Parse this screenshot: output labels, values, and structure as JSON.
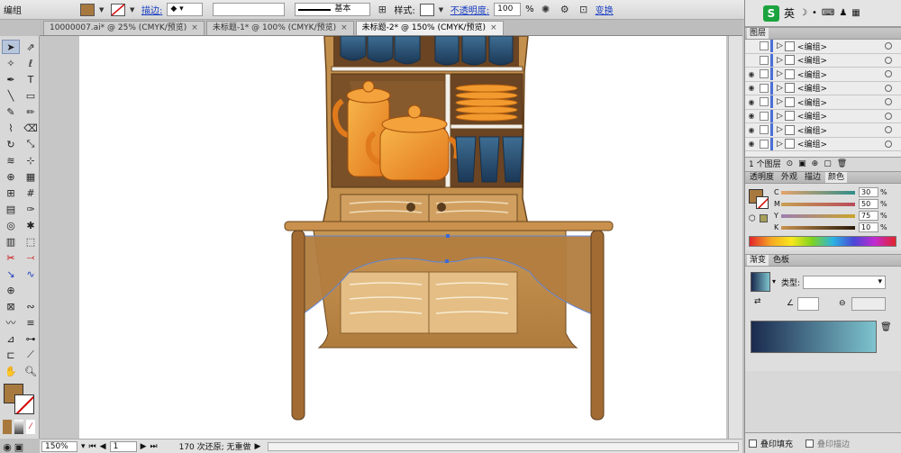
{
  "control_bar": {
    "object_type": "编组",
    "fill_color": "#a8793e",
    "stroke_label": "描边:",
    "style_label": "基本",
    "style_prefix": "样式:",
    "opacity_label": "不透明度:",
    "opacity_value": "100",
    "percent": "%",
    "transform_label": "变换"
  },
  "document_tabs": [
    {
      "label": "10000007.ai* @ 25% (CMYK/预览)",
      "close": "×"
    },
    {
      "label": "未标题-1* @ 100% (CMYK/预览)",
      "close": "×"
    },
    {
      "label": "未标题-2* @ 150% (CMYK/预览)",
      "close": "×"
    }
  ],
  "status_bar": {
    "zoom": "150%",
    "page": "1",
    "history": "170 次还原; 无重做"
  },
  "system_tray": {
    "ime": "英"
  },
  "layers_panel": {
    "title": "图层",
    "rows": [
      "<编组>",
      "<编组>",
      "<编组>",
      "<编组>",
      "<编组>",
      "<编组>",
      "<编组>",
      "<编组>"
    ],
    "footer_count": "1 个图层"
  },
  "color_panel": {
    "tabs": [
      "透明度",
      "外观",
      "描边",
      "颜色"
    ],
    "channels": [
      {
        "label": "C",
        "value": "30"
      },
      {
        "label": "M",
        "value": "50"
      },
      {
        "label": "Y",
        "value": "75"
      },
      {
        "label": "K",
        "value": "10"
      }
    ]
  },
  "gradient_panel": {
    "tabs": [
      "渐变",
      "色板"
    ],
    "type_label": "类型:",
    "gradient_start": "#1a2a4e",
    "gradient_end": "#7ec4cf"
  },
  "bottom_panel": {
    "overprint_fill": "叠印填充",
    "overprint_stroke": "叠印描边"
  }
}
